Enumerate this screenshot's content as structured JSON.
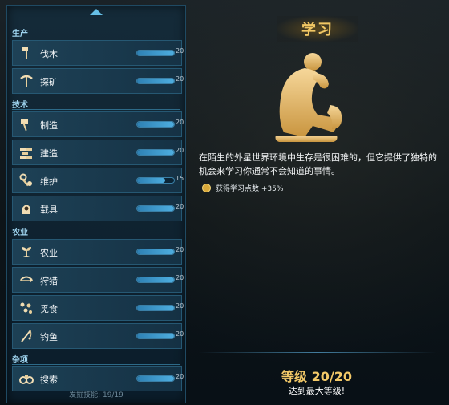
{
  "categories": {
    "production": "生产",
    "technology": "技术",
    "agriculture": "农业",
    "misc": "杂项"
  },
  "skills": [
    {
      "name": "伐木",
      "value": "20",
      "level": 20,
      "icon": "axe-icon"
    },
    {
      "name": "探矿",
      "value": "20",
      "level": 20,
      "icon": "pickaxe-icon"
    },
    {
      "name": "制造",
      "value": "20",
      "level": 20,
      "icon": "hammer-icon"
    },
    {
      "name": "建造",
      "value": "20",
      "level": 20,
      "icon": "bricks-icon"
    },
    {
      "name": "维护",
      "value": "15",
      "level": 15,
      "icon": "wrench-icon"
    },
    {
      "name": "载具",
      "value": "20",
      "level": 20,
      "icon": "vehicle-icon"
    },
    {
      "name": "农业",
      "value": "20",
      "level": 20,
      "icon": "sprout-icon"
    },
    {
      "name": "狩猎",
      "value": "20",
      "level": 20,
      "icon": "bow-icon"
    },
    {
      "name": "觅食",
      "value": "20",
      "level": 20,
      "icon": "berries-icon"
    },
    {
      "name": "钓鱼",
      "value": "20",
      "level": 20,
      "icon": "fishing-rod-icon"
    },
    {
      "name": "搜索",
      "value": "20",
      "level": 20,
      "icon": "binoculars-icon"
    }
  ],
  "footer": "发掘技能: 19/19",
  "detail": {
    "title": "学习",
    "description": "在陌生的外星世界环境中生存是很困难的，但它提供了独特的机会来学习你通常不会知道的事情。",
    "bonus": "获得学习点数 +35%",
    "level_text": "等级 20/20",
    "max_text": "达到最大等级!"
  },
  "colors": {
    "accent_gold": "#f1c764",
    "bar_fill": "#4eaee0",
    "panel_border": "#1f4a63"
  }
}
